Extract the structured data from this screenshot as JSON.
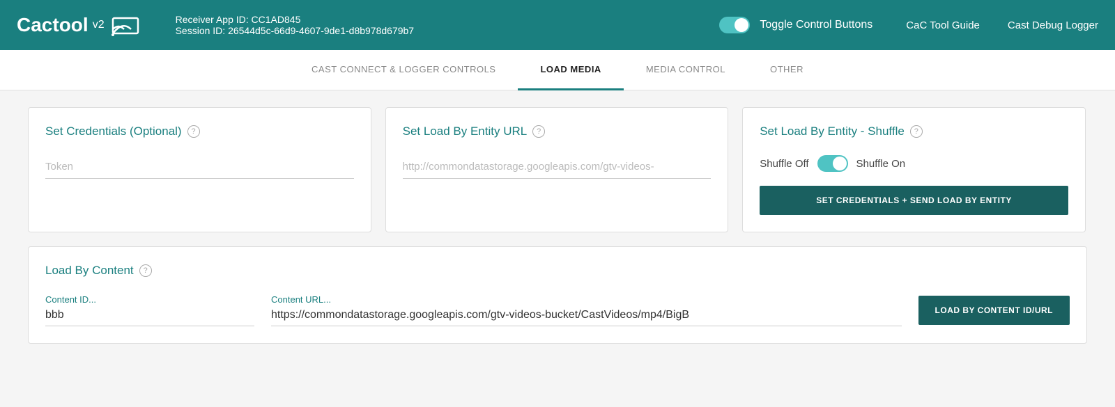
{
  "header": {
    "logo_text": "Cactool",
    "logo_version": "v2",
    "receiver_label": "Receiver App ID:",
    "receiver_id": "CC1AD845",
    "session_label": "Session ID:",
    "session_id": "26544d5c-66d9-4607-9de1-d8b978d679b7",
    "toggle_label": "Toggle Control Buttons",
    "nav_links": [
      {
        "label": "CaC Tool Guide"
      },
      {
        "label": "Cast Debug Logger"
      }
    ]
  },
  "tabs": [
    {
      "label": "CAST CONNECT & LOGGER CONTROLS",
      "active": false
    },
    {
      "label": "LOAD MEDIA",
      "active": true
    },
    {
      "label": "MEDIA CONTROL",
      "active": false
    },
    {
      "label": "OTHER",
      "active": false
    }
  ],
  "main": {
    "cards_row1": [
      {
        "id": "set-credentials",
        "title": "Set Credentials (Optional)",
        "input_placeholder": "Token"
      },
      {
        "id": "set-load-entity-url",
        "title": "Set Load By Entity URL",
        "input_placeholder": "http://commondatastorage.googleapis.com/gtv-videos-"
      },
      {
        "id": "set-load-entity-shuffle",
        "title": "Set Load By Entity - Shuffle",
        "shuffle_off_label": "Shuffle Off",
        "shuffle_on_label": "Shuffle On",
        "button_label": "SET CREDENTIALS + SEND LOAD BY ENTITY"
      }
    ],
    "card_load_content": {
      "title": "Load By Content",
      "content_id_label": "Content ID...",
      "content_id_value": "bbb",
      "content_url_label": "Content URL...",
      "content_url_value": "https://commondatastorage.googleapis.com/gtv-videos-bucket/CastVideos/mp4/BigB",
      "button_label": "LOAD BY CONTENT ID/URL"
    }
  }
}
